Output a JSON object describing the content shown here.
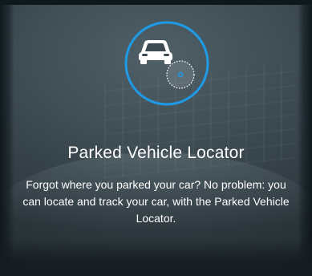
{
  "feature": {
    "title": "Parked Vehicle Locator",
    "description": "Forgot where you parked your car? No problem: you can locate and track your car, with the Parked Vehicle Locator."
  },
  "icons": {
    "main": "car-location-icon",
    "car": "car-icon",
    "locator": "location-dot-icon"
  },
  "colors": {
    "accent": "#1e9be6",
    "text": "#ffffff"
  }
}
